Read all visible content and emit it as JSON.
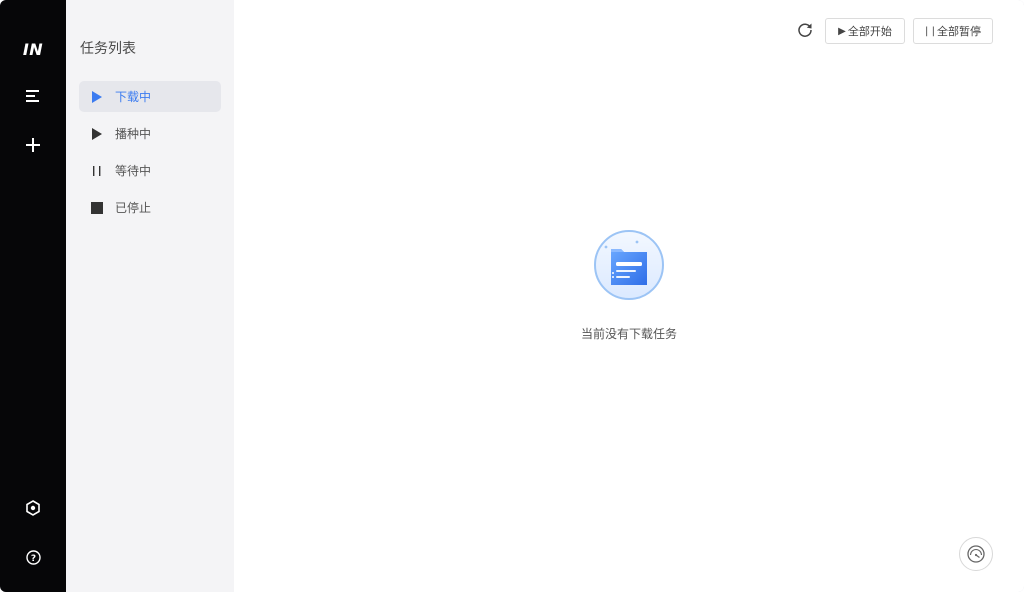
{
  "app": {
    "logo_text": "IN"
  },
  "rail": {
    "items": [
      {
        "icon": "menu-icon"
      },
      {
        "icon": "plus-icon"
      },
      {
        "icon": "settings-icon"
      },
      {
        "icon": "help-icon"
      }
    ]
  },
  "panel": {
    "title": "任务列表",
    "items": [
      {
        "label": "下载中",
        "icon": "play-icon",
        "active": true
      },
      {
        "label": "播种中",
        "icon": "play-icon",
        "active": false
      },
      {
        "label": "等待中",
        "icon": "pause-icon",
        "active": false
      },
      {
        "label": "已停止",
        "icon": "stop-icon",
        "active": false
      }
    ]
  },
  "toolbar": {
    "refresh_icon": "refresh-icon",
    "start_all_glyph": "▶",
    "start_all_label": "全部开始",
    "pause_all_glyph": "| |",
    "pause_all_label": "全部暂停"
  },
  "main": {
    "empty_text": "当前没有下载任务",
    "empty_icon": "empty-document-icon",
    "speed_icon": "speedometer-icon"
  },
  "colors": {
    "accent": "#3b7bf0",
    "rail_bg": "#060608",
    "panel_bg": "#f4f4f6",
    "active_item_bg": "#e6e7ec"
  }
}
